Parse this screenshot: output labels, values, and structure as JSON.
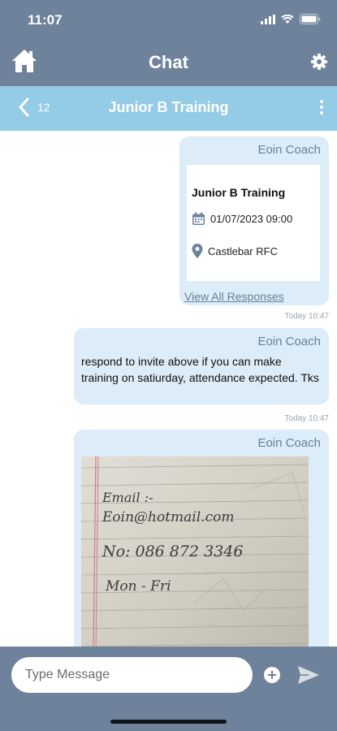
{
  "status_bar": {
    "time": "11:07"
  },
  "app_header": {
    "title": "Chat",
    "home_icon": "home-icon",
    "settings_icon": "gear-icon"
  },
  "chat_header": {
    "back_count": "12",
    "title": "Junior B Training",
    "more_icon": "more-vertical-icon"
  },
  "messages": [
    {
      "sender": "Eoin Coach",
      "type": "event",
      "event": {
        "title": "Junior B Training",
        "datetime": "01/07/2023 09:00",
        "location": "Castlebar RFC",
        "link_label": "View All Responses"
      },
      "timestamp": "Today 10:47"
    },
    {
      "sender": "Eoin Coach",
      "type": "text",
      "text": "respond to invite above if you can make training on satiurday, attendance expected. Tks",
      "timestamp": "Today 10:47"
    },
    {
      "sender": "Eoin Coach",
      "type": "image",
      "image_text": [
        "Email :-",
        "Eoin@hotmail.com",
        "No: 086 872 3346",
        "Mon - Fri"
      ]
    }
  ],
  "composer": {
    "placeholder": "Type Message",
    "attach_icon": "add-circle-icon",
    "send_icon": "send-icon"
  },
  "colors": {
    "header": "#6e829b",
    "chat_header": "#94cbe6",
    "bubble": "#dcecf8"
  }
}
